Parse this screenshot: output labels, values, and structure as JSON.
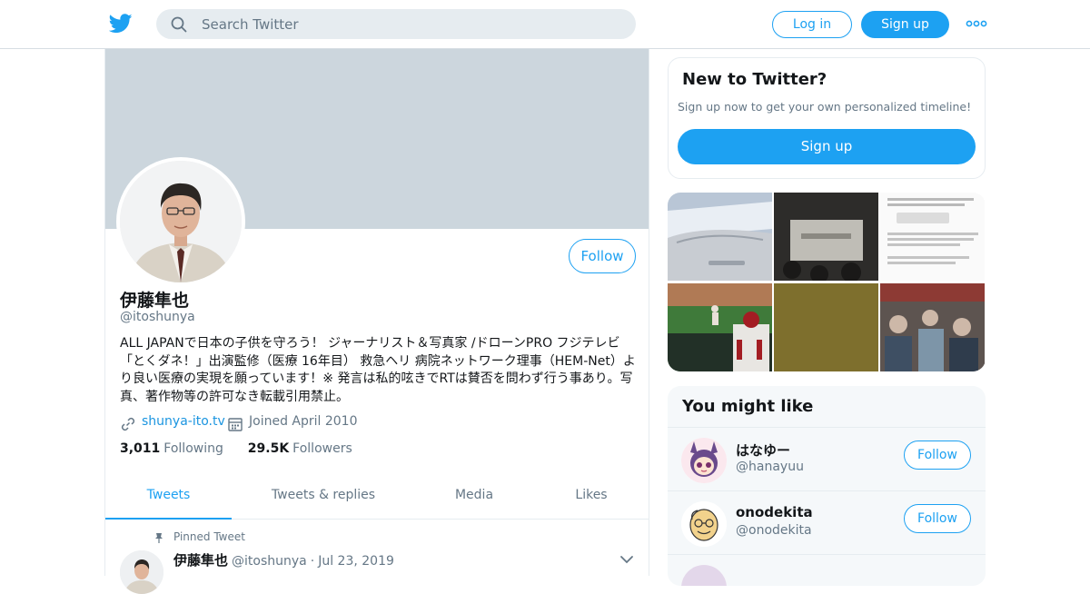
{
  "header": {
    "search_placeholder": "Search Twitter",
    "login_label": "Log in",
    "signup_label": "Sign up",
    "icons": [
      "twitter-logo-icon",
      "search-icon",
      "more-icon"
    ]
  },
  "profile": {
    "name": "伊藤隼也",
    "handle": "@itoshunya",
    "follow_label": "Follow",
    "bio": "ALL JAPANで日本の子供を守ろう！ ジャーナリスト＆写真家 /ドローンPRO フジテレビ「とくダネ！」出演監修（医療 16年目） 救急ヘリ 病院ネットワーク理事（HEM-Net）より良い医療の実現を願っています！※ 発言は私的呟きでRTは賛否を問わず行う事あり。写真、著作物等の許可なき転載引用禁止。",
    "website": "shunya-ito.tv",
    "joined": "Joined April 2010",
    "following_count": "3,011",
    "following_label": "Following",
    "followers_count": "29.5K",
    "followers_label": "Followers"
  },
  "tabs": [
    {
      "label": "Tweets",
      "active": true
    },
    {
      "label": "Tweets & replies",
      "active": false
    },
    {
      "label": "Media",
      "active": false
    },
    {
      "label": "Likes",
      "active": false
    }
  ],
  "pinned_tweet": {
    "label": "Pinned Tweet",
    "author_name": "伊藤隼也",
    "author_handle": "@itoshunya",
    "separator": "·",
    "date": "Jul 23, 2019"
  },
  "new_to_twitter": {
    "title": "New to Twitter?",
    "subtitle": "Sign up now to get your own personalized timeline!",
    "signup_label": "Sign up"
  },
  "you_might_like": {
    "title": "You might like",
    "users": [
      {
        "name": "はなゆー",
        "handle": "@hanayuu",
        "follow_label": "Follow"
      },
      {
        "name": "onodekita",
        "handle": "@onodekita",
        "follow_label": "Follow"
      }
    ]
  },
  "colors": {
    "accent": "#1da1f2",
    "banner": "#ccd6dd",
    "secondary_text": "#657786"
  }
}
